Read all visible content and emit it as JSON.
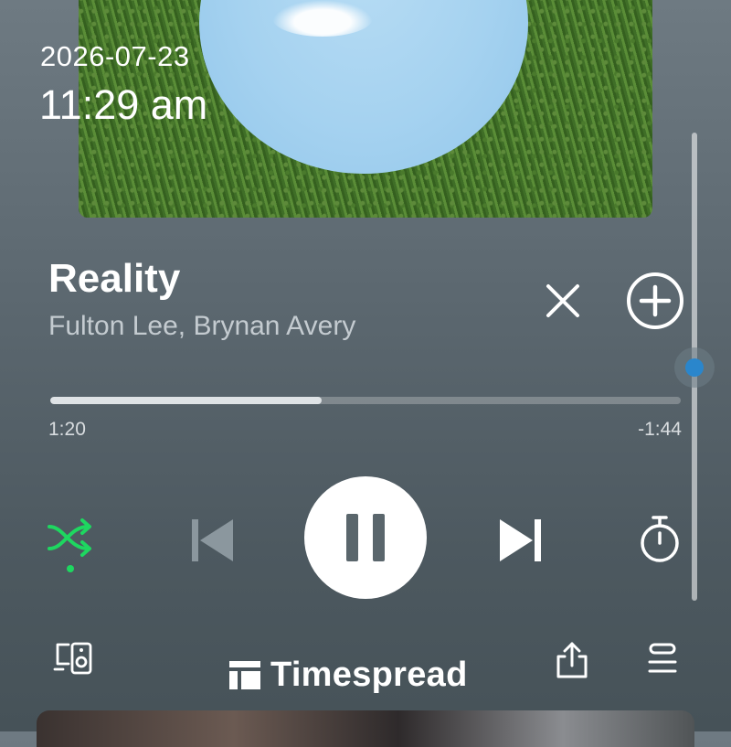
{
  "status": {
    "date": "2026-07-23",
    "time": "11:29 am"
  },
  "track": {
    "title": "Reality",
    "artists": "Fulton Lee, Brynan Avery",
    "elapsed": "1:20",
    "remaining": "-1:44",
    "progress_fraction": 0.43
  },
  "controls": {
    "shuffle_active": true,
    "shuffle_color": "#1ed760",
    "state": "playing"
  },
  "brand": {
    "name": "Timespread"
  },
  "icons": {
    "close": "close-icon",
    "add": "add-circle-icon",
    "shuffle": "shuffle-icon",
    "previous": "skip-previous-icon",
    "pause": "pause-icon",
    "next": "skip-next-icon",
    "timer": "sleep-timer-icon",
    "devices": "connect-device-icon",
    "share": "share-icon",
    "queue": "queue-icon",
    "brand": "brand-logo-icon"
  }
}
